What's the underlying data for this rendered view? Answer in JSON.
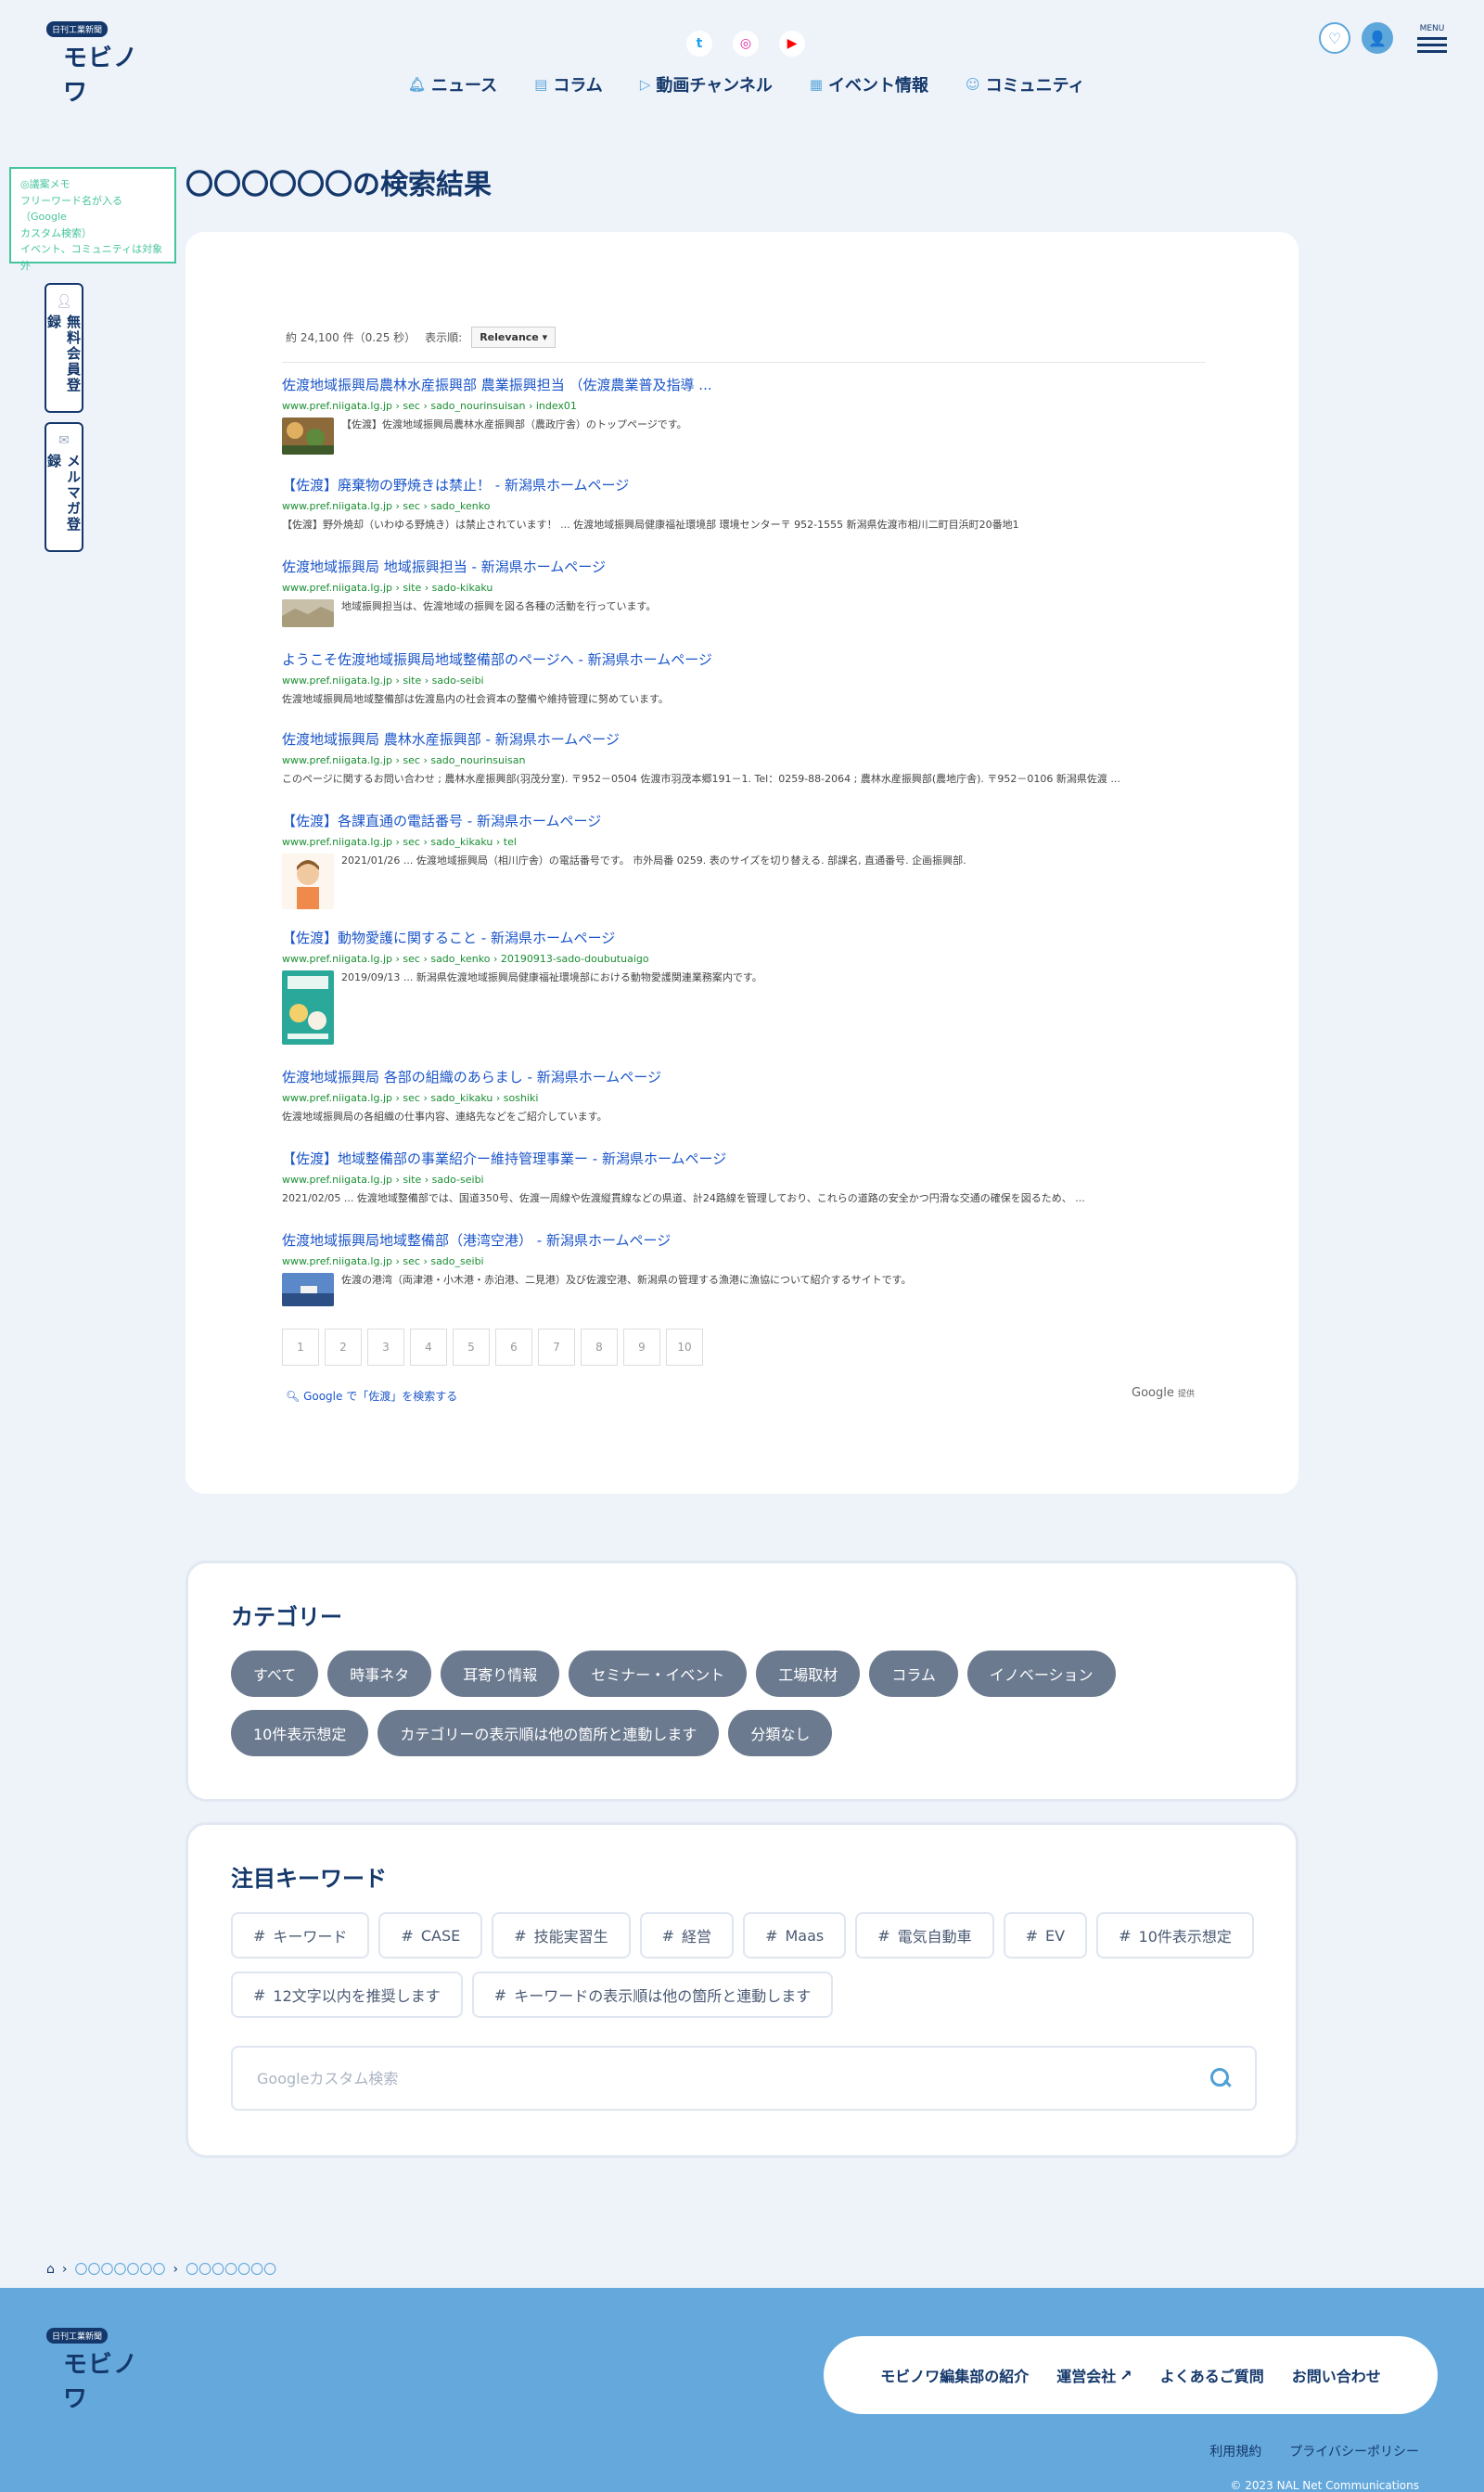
{
  "header": {
    "logo_badge": "日刊工業新聞",
    "logo_text": "モビノワ",
    "social": [
      "twitter-icon",
      "instagram-icon",
      "youtube-icon"
    ],
    "menu_label": "MENU",
    "nav": [
      {
        "label": "ニュース",
        "icon": "bell-icon"
      },
      {
        "label": "コラム",
        "icon": "document-icon"
      },
      {
        "label": "動画チャンネル",
        "icon": "play-icon"
      },
      {
        "label": "イベント情報",
        "icon": "calendar-icon"
      },
      {
        "label": "コミュニティ",
        "icon": "community-icon"
      }
    ]
  },
  "memo": {
    "line1": "◎議案メモ",
    "line2": "フリーワード名が入る（Google",
    "line3": "カスタム検索）",
    "line4": "イベント、コミュニティは対象外"
  },
  "side": {
    "register": "無料会員登録",
    "newsletter": "メルマガ登録"
  },
  "page": {
    "title": "〇〇〇〇〇〇の検索結果"
  },
  "results": {
    "count": "約 24,100 件（0.25 秒）",
    "sort_label": "表示順:",
    "sort_value": "Relevance",
    "items": [
      {
        "title": "佐渡地域振興局農林水産振興部 農業振興担当 （佐渡農業普及指導 ...",
        "url": "www.pref.niigata.lg.jp › sec › sado_nourinsuisan › index01",
        "snippet": "【佐渡】佐渡地域振興局農林水産振興部（農政庁舎）のトップページです。"
      },
      {
        "title": "【佐渡】廃棄物の野焼きは禁止！ - 新潟県ホームページ",
        "url": "www.pref.niigata.lg.jp › sec › sado_kenko",
        "snippet": "【佐渡】野外焼却（いわゆる野焼き）は禁止されています！ ... 佐渡地域振興局健康福祉環境部 環境センター〒 952-1555 新潟県佐渡市相川二町目浜町20番地1"
      },
      {
        "title": "佐渡地域振興局 地域振興担当 - 新潟県ホームページ",
        "url": "www.pref.niigata.lg.jp › site › sado-kikaku",
        "snippet": "地域振興担当は、佐渡地域の振興を図る各種の活動を行っています。"
      },
      {
        "title": "ようこそ佐渡地域振興局地域整備部のページへ - 新潟県ホームページ",
        "url": "www.pref.niigata.lg.jp › site › sado-seibi",
        "snippet": "佐渡地域振興局地域整備部は佐渡島内の社会資本の整備や維持管理に努めています。"
      },
      {
        "title": "佐渡地域振興局 農林水産振興部 - 新潟県ホームページ",
        "url": "www.pref.niigata.lg.jp › sec › sado_nourinsuisan",
        "snippet": "このページに関するお問い合わせ ; 農林水産振興部(羽茂分室). 〒952－0504 佐渡市羽茂本郷191－1. Tel：0259-88-2064 ; 農林水産振興部(農地庁舎). 〒952－0106 新潟県佐渡 ..."
      },
      {
        "title": "【佐渡】各課直通の電話番号 - 新潟県ホームページ",
        "url": "www.pref.niigata.lg.jp › sec › sado_kikaku › tel",
        "snippet": "2021/01/26 ... 佐渡地域振興局（相川庁舎）の電話番号です。 市外局番 0259. 表のサイズを切り替える. 部課名, 直通番号. 企画振興部."
      },
      {
        "title": "【佐渡】動物愛護に関すること - 新潟県ホームページ",
        "url": "www.pref.niigata.lg.jp › sec › sado_kenko › 20190913-sado-doubutuaigo",
        "snippet": "2019/09/13 ... 新潟県佐渡地域振興局健康福祉環境部における動物愛護関連業務案内です。"
      },
      {
        "title": "佐渡地域振興局 各部の組織のあらまし - 新潟県ホームページ",
        "url": "www.pref.niigata.lg.jp › sec › sado_kikaku › soshiki",
        "snippet": "佐渡地域振興局の各組織の仕事内容、連絡先などをご紹介しています。"
      },
      {
        "title": "【佐渡】地域整備部の事業紹介ー維持管理事業ー - 新潟県ホームページ",
        "url": "www.pref.niigata.lg.jp › site › sado-seibi",
        "snippet": "2021/02/05 ... 佐渡地域整備部では、国道350号、佐渡一周線や佐渡縦貫線などの県道、計24路線を管理しており、これらの道路の安全かつ円滑な交通の確保を図るため、 ..."
      },
      {
        "title": "佐渡地域振興局地域整備部（港湾空港） - 新潟県ホームページ",
        "url": "www.pref.niigata.lg.jp › sec › sado_seibi",
        "snippet": "佐渡の港湾（両津港・小木港・赤泊港、二見港）及び佐渡空港、新潟県の管理する漁港に漁協について紹介するサイトです。"
      }
    ],
    "pages": [
      "1",
      "2",
      "3",
      "4",
      "5",
      "6",
      "7",
      "8",
      "9",
      "10"
    ],
    "google_search": "Google で「佐渡」を検索する",
    "google_brand": "Google",
    "google_brand_sub": "提供"
  },
  "category": {
    "title": "カテゴリー",
    "chips": [
      "すべて",
      "時事ネタ",
      "耳寄り情報",
      "セミナー・イベント",
      "工場取材",
      "コラム",
      "イノベーション",
      "10件表示想定",
      "カテゴリーの表示順は他の箇所と連動します",
      "分類なし"
    ]
  },
  "keywords": {
    "title": "注目キーワード",
    "tags": [
      "キーワード",
      "CASE",
      "技能実習生",
      "経営",
      "Maas",
      "電気自動車",
      "EV",
      "10件表示想定",
      "12文字以内を推奨します",
      "キーワードの表示順は他の箇所と連動します"
    ],
    "search_placeholder": "Googleカスタム検索"
  },
  "breadcrumb": {
    "item1": "〇〇〇〇〇〇〇",
    "item2": "〇〇〇〇〇〇〇"
  },
  "footer": {
    "logo_badge": "日刊工業新聞",
    "logo_text": "モビノワ",
    "nav": [
      "モビノワ編集部の紹介",
      "運営会社",
      "よくあるご質問",
      "お問い合わせ"
    ],
    "links": [
      "利用規約",
      "プライバシーポリシー"
    ],
    "copyright": "© 2023 NAL Net Communications"
  },
  "colors": {
    "accent": "#5ea7db",
    "navy": "#14386b",
    "memo_green": "#46c49e",
    "footer_bg": "#65a9dc",
    "chip_bg": "#6b7a8f"
  }
}
